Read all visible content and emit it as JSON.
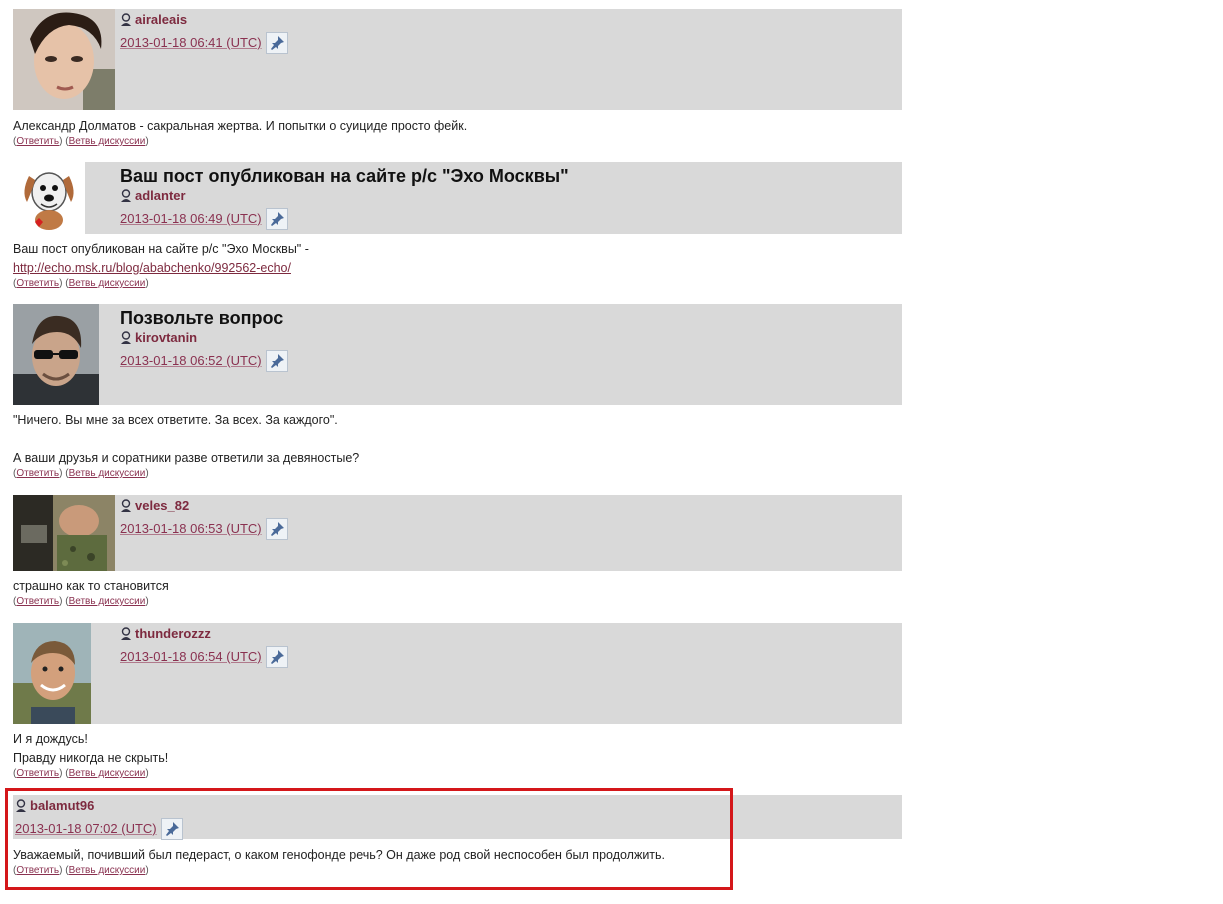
{
  "comments": [
    {
      "title": "",
      "username": "airaleais",
      "date": "2013-01-18 06:41 (UTC)",
      "lines": [
        "Александр Долматов - сакральная жертва. И попытки о суициде просто фейк."
      ],
      "avatar": "young-man-portrait"
    },
    {
      "title": "Ваш пост опубликован на сайте р/с \"Эхо Москвы\"",
      "username": "adlanter",
      "date": "2013-01-18 06:49 (UTC)",
      "lines": [
        "Ваш пост опубликован на сайте р/с \"Эхо Москвы\" -"
      ],
      "link": "http://echo.msk.ru/blog/ababchenko/992562-echo/",
      "avatar": "cartoon-dog"
    },
    {
      "title": "Позвольте вопрос",
      "username": "kirovtanin",
      "date": "2013-01-18 06:52 (UTC)",
      "lines": [
        "\"Ничего. Вы мне за всех ответите. За всех. За каждого\".",
        "",
        "А ваши друзья и соратники разве ответили за девяностые?"
      ],
      "avatar": "man-sunglasses"
    },
    {
      "title": "",
      "username": "veles_82",
      "date": "2013-01-18 06:53 (UTC)",
      "lines": [
        "страшно как то становится"
      ],
      "avatar": "soldier-photo"
    },
    {
      "title": "",
      "username": "thunderozzz",
      "date": "2013-01-18 06:54 (UTC)",
      "lines": [
        "И я дождусь!",
        "Правду никогда не скрыть!"
      ],
      "avatar": "smiling-man"
    },
    {
      "title": "",
      "username": "balamut96",
      "date": "2013-01-18 07:02 (UTC)",
      "lines": [
        "Уважаемый, почивший был педераст, о каком генофонде речь? Он даже род свой неспособен был продолжить."
      ],
      "avatar": ""
    }
  ],
  "actions": {
    "reply": "Ответить",
    "thread": "Ветвь дискуссии"
  },
  "colors": {
    "header_bg": "#d9d9d9",
    "username": "#7d2a3f",
    "highlight_border": "#d4171a"
  }
}
